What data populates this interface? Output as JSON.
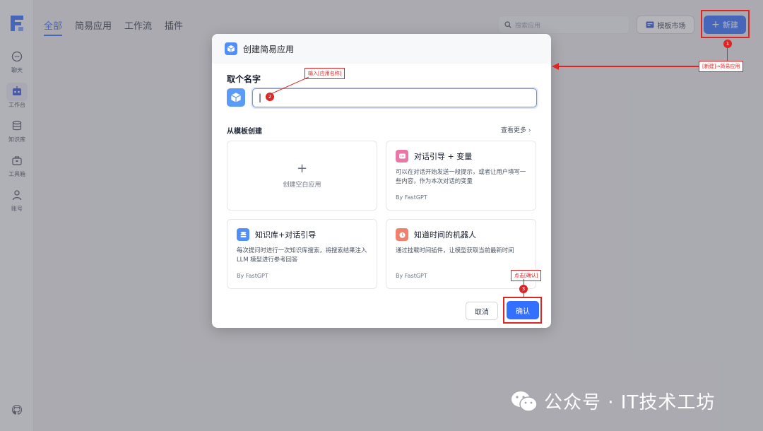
{
  "sidebar": {
    "items": [
      {
        "label": "聊天",
        "icon": "chat-icon"
      },
      {
        "label": "工作台",
        "icon": "robot-icon"
      },
      {
        "label": "知识库",
        "icon": "database-icon"
      },
      {
        "label": "工具箱",
        "icon": "toolbox-icon"
      },
      {
        "label": "账号",
        "icon": "user-icon"
      }
    ]
  },
  "header": {
    "tabs": [
      {
        "label": "全部"
      },
      {
        "label": "简易应用"
      },
      {
        "label": "工作流"
      },
      {
        "label": "插件"
      }
    ],
    "search_placeholder": "搜索应用",
    "template_market": "模板市场",
    "new_button": "新建"
  },
  "modal": {
    "title": "创建简易应用",
    "name_label": "取个名字",
    "name_value": "|",
    "template_label": "从模板创建",
    "see_more": "查看更多",
    "blank_card": "创建空白应用",
    "templates": [
      {
        "title": "对话引导 + 变量",
        "desc": "可以在对话开始发送一段提示，或者让用户填写一些内容，作为本次对话的变量",
        "by": "By FastGPT",
        "color": "#e879a6"
      },
      {
        "title": "知识库+对话引导",
        "desc": "每次提问时进行一次知识库搜索，将搜索结果注入 LLM 模型进行参考回答",
        "by": "By FastGPT",
        "color": "#4f8ff7"
      },
      {
        "title": "知道时间的机器人",
        "desc": "通过挂载时间插件，让模型获取当前最新时间",
        "by": "By FastGPT",
        "color": "#f0826d"
      }
    ],
    "cancel": "取消",
    "confirm": "确认"
  },
  "annotations": {
    "step1": "1",
    "step1_text": "[新建]→简易应用",
    "step2": "2",
    "step2_text": "输入[应用名称]",
    "step3": "3",
    "step3_text": "点击[确认]"
  },
  "watermark": "公众号 · IT技术工坊",
  "colors": {
    "primary": "#3370ff",
    "annotation": "#e02424"
  }
}
